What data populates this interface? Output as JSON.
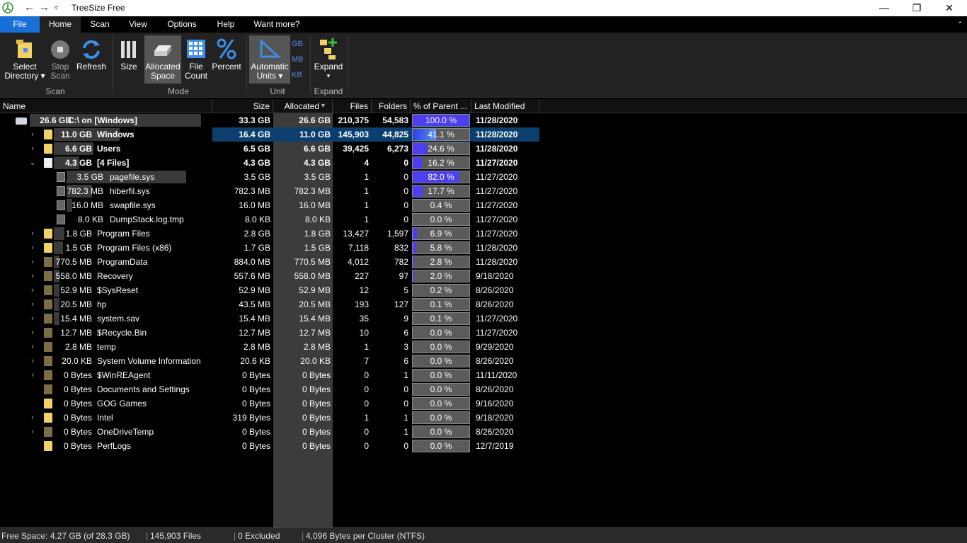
{
  "window": {
    "title": "TreeSize Free",
    "controls": [
      "—",
      "❐",
      "✕"
    ]
  },
  "menu": {
    "items": [
      "File",
      "Home",
      "Scan",
      "View",
      "Options",
      "Help",
      "Want more?"
    ]
  },
  "ribbon": {
    "select_directory": [
      "Select",
      "Directory ▾"
    ],
    "stop_scan": [
      "Stop",
      "Scan"
    ],
    "refresh": [
      "Refresh"
    ],
    "size": [
      "Size"
    ],
    "allocated_space": [
      "Allocated",
      "Space"
    ],
    "file_count": [
      "File",
      "Count"
    ],
    "percent": [
      "Percent"
    ],
    "automatic_units": [
      "Automatic",
      "Units ▾"
    ],
    "unit_gb": "GB",
    "unit_mb": "MB",
    "unit_kb": "KB",
    "expand": [
      "Expand",
      "▾"
    ],
    "groups": {
      "scan": "Scan",
      "mode": "Mode",
      "unit": "Unit",
      "expand": "Expand"
    }
  },
  "columns": {
    "name": "Name",
    "size": "Size",
    "allocated": "Allocated",
    "files": "Files",
    "folders": "Folders",
    "percent": "% of Parent ...",
    "modified": "Last Modified"
  },
  "rows": [
    {
      "expander": "⌄",
      "icon": "drive",
      "bar": 1.0,
      "alloc": "26.6 GB",
      "name": "C:\\  on  [Windows]",
      "size": "33.3 GB",
      "allocated": "26.6 GB",
      "files": "210,375",
      "folders": "54,583",
      "pct": 100.0,
      "pct_text": "100.0 %",
      "modified": "11/28/2020",
      "bold": true,
      "level": 0
    },
    {
      "expander": "›",
      "icon": "folder",
      "bar": 0.413,
      "alloc": "11.0 GB",
      "name": "Windows",
      "size": "16.4 GB",
      "allocated": "11.0 GB",
      "files": "145,903",
      "folders": "44,825",
      "pct": 41.1,
      "pct_text": "41.1 %",
      "modified": "11/28/2020",
      "bold": true,
      "level": 1,
      "selected": true
    },
    {
      "expander": "›",
      "icon": "folder",
      "bar": 0.248,
      "alloc": "6.6 GB",
      "name": "Users",
      "size": "6.5 GB",
      "allocated": "6.6 GB",
      "files": "39,425",
      "folders": "6,273",
      "pct": 24.6,
      "pct_text": "24.6 %",
      "modified": "11/28/2020",
      "bold": true,
      "level": 1
    },
    {
      "expander": "⌄",
      "icon": "file",
      "bar": 0.162,
      "alloc": "4.3 GB",
      "name": "[4 Files]",
      "size": "4.3 GB",
      "allocated": "4.3 GB",
      "files": "4",
      "folders": "0",
      "pct": 16.2,
      "pct_text": "16.2 %",
      "modified": "11/27/2020",
      "bold": true,
      "level": 1
    },
    {
      "expander": "",
      "icon": "sysfile",
      "bar": 0.82,
      "alloc": "3.5 GB",
      "name": "pagefile.sys",
      "size": "3.5 GB",
      "allocated": "3.5 GB",
      "files": "1",
      "folders": "0",
      "pct": 82.0,
      "pct_text": "82.0 %",
      "modified": "11/27/2020",
      "bold": false,
      "level": 2
    },
    {
      "expander": "",
      "icon": "sysfile",
      "bar": 0.177,
      "alloc": "782.3 MB",
      "name": "hiberfil.sys",
      "size": "782.3 MB",
      "allocated": "782.3 MB",
      "files": "1",
      "folders": "0",
      "pct": 17.7,
      "pct_text": "17.7 %",
      "modified": "11/27/2020",
      "bold": false,
      "level": 2
    },
    {
      "expander": "",
      "icon": "sysfile",
      "bar": 0.004,
      "alloc": "16.0 MB",
      "name": "swapfile.sys",
      "size": "16.0 MB",
      "allocated": "16.0 MB",
      "files": "1",
      "folders": "0",
      "pct": 0.4,
      "pct_text": "0.4 %",
      "modified": "11/27/2020",
      "bold": false,
      "level": 2
    },
    {
      "expander": "",
      "icon": "sysfile",
      "bar": 0.0,
      "alloc": "8.0 KB",
      "name": "DumpStack.log.tmp",
      "size": "8.0 KB",
      "allocated": "8.0 KB",
      "files": "1",
      "folders": "0",
      "pct": 0.0,
      "pct_text": "0.0 %",
      "modified": "11/27/2020",
      "bold": false,
      "level": 2
    },
    {
      "expander": "›",
      "icon": "folder",
      "bar": 0.069,
      "alloc": "1.8 GB",
      "name": "Program Files",
      "size": "2.8 GB",
      "allocated": "1.8 GB",
      "files": "13,427",
      "folders": "1,597",
      "pct": 6.9,
      "pct_text": "6.9 %",
      "modified": "11/27/2020",
      "bold": false,
      "level": 1
    },
    {
      "expander": "›",
      "icon": "folder",
      "bar": 0.058,
      "alloc": "1.5 GB",
      "name": "Program Files (x86)",
      "size": "1.7 GB",
      "allocated": "1.5 GB",
      "files": "7,118",
      "folders": "832",
      "pct": 5.8,
      "pct_text": "5.8 %",
      "modified": "11/28/2020",
      "bold": false,
      "level": 1
    },
    {
      "expander": "›",
      "icon": "folderdim",
      "bar": 0.028,
      "alloc": "770.5 MB",
      "name": "ProgramData",
      "size": "884.0 MB",
      "allocated": "770.5 MB",
      "files": "4,012",
      "folders": "782",
      "pct": 2.8,
      "pct_text": "2.8 %",
      "modified": "11/28/2020",
      "bold": false,
      "level": 1
    },
    {
      "expander": "›",
      "icon": "folderdim",
      "bar": 0.02,
      "alloc": "558.0 MB",
      "name": "Recovery",
      "size": "557.6 MB",
      "allocated": "558.0 MB",
      "files": "227",
      "folders": "97",
      "pct": 2.0,
      "pct_text": "2.0 %",
      "modified": "9/18/2020",
      "bold": false,
      "level": 1
    },
    {
      "expander": "›",
      "icon": "folderdim",
      "bar": 0.002,
      "alloc": "52.9 MB",
      "name": "$SysReset",
      "size": "52.9 MB",
      "allocated": "52.9 MB",
      "files": "12",
      "folders": "5",
      "pct": 0.2,
      "pct_text": "0.2 %",
      "modified": "8/26/2020",
      "bold": false,
      "level": 1
    },
    {
      "expander": "›",
      "icon": "folderdim",
      "bar": 0.001,
      "alloc": "20.5 MB",
      "name": "hp",
      "size": "43.5 MB",
      "allocated": "20.5 MB",
      "files": "193",
      "folders": "127",
      "pct": 0.1,
      "pct_text": "0.1 %",
      "modified": "8/26/2020",
      "bold": false,
      "level": 1
    },
    {
      "expander": "›",
      "icon": "folderdim",
      "bar": 0.001,
      "alloc": "15.4 MB",
      "name": "system.sav",
      "size": "15.4 MB",
      "allocated": "15.4 MB",
      "files": "35",
      "folders": "9",
      "pct": 0.1,
      "pct_text": "0.1 %",
      "modified": "11/27/2020",
      "bold": false,
      "level": 1
    },
    {
      "expander": "›",
      "icon": "folderdim",
      "bar": 0.0,
      "alloc": "12.7 MB",
      "name": "$Recycle.Bin",
      "size": "12.7 MB",
      "allocated": "12.7 MB",
      "files": "10",
      "folders": "6",
      "pct": 0.0,
      "pct_text": "0.0 %",
      "modified": "11/27/2020",
      "bold": false,
      "level": 1
    },
    {
      "expander": "›",
      "icon": "folderdim",
      "bar": 0.0,
      "alloc": "2.8 MB",
      "name": "temp",
      "size": "2.8 MB",
      "allocated": "2.8 MB",
      "files": "1",
      "folders": "3",
      "pct": 0.0,
      "pct_text": "0.0 %",
      "modified": "9/29/2020",
      "bold": false,
      "level": 1
    },
    {
      "expander": "›",
      "icon": "folderdim",
      "bar": 0.0,
      "alloc": "20.0 KB",
      "name": "System Volume Information",
      "size": "20.6 KB",
      "allocated": "20.0 KB",
      "files": "7",
      "folders": "6",
      "pct": 0.0,
      "pct_text": "0.0 %",
      "modified": "8/26/2020",
      "bold": false,
      "level": 1
    },
    {
      "expander": "›",
      "icon": "folderdim",
      "bar": 0.0,
      "alloc": "0 Bytes",
      "name": "$WinREAgent",
      "size": "0 Bytes",
      "allocated": "0 Bytes",
      "files": "0",
      "folders": "1",
      "pct": 0.0,
      "pct_text": "0.0 %",
      "modified": "11/11/2020",
      "bold": false,
      "level": 1
    },
    {
      "expander": "",
      "icon": "folderdim",
      "bar": 0.0,
      "alloc": "0 Bytes",
      "name": "Documents and Settings",
      "size": "0 Bytes",
      "allocated": "0 Bytes",
      "files": "0",
      "folders": "0",
      "pct": 0.0,
      "pct_text": "0.0 %",
      "modified": "8/26/2020",
      "bold": false,
      "level": 1
    },
    {
      "expander": "",
      "icon": "folder",
      "bar": 0.0,
      "alloc": "0 Bytes",
      "name": "GOG Games",
      "size": "0 Bytes",
      "allocated": "0 Bytes",
      "files": "0",
      "folders": "0",
      "pct": 0.0,
      "pct_text": "0.0 %",
      "modified": "9/16/2020",
      "bold": false,
      "level": 1
    },
    {
      "expander": "›",
      "icon": "folder",
      "bar": 0.0,
      "alloc": "0 Bytes",
      "name": "Intel",
      "size": "319 Bytes",
      "allocated": "0 Bytes",
      "files": "1",
      "folders": "1",
      "pct": 0.0,
      "pct_text": "0.0 %",
      "modified": "9/18/2020",
      "bold": false,
      "level": 1
    },
    {
      "expander": "›",
      "icon": "folderdim",
      "bar": 0.0,
      "alloc": "0 Bytes",
      "name": "OneDriveTemp",
      "size": "0 Bytes",
      "allocated": "0 Bytes",
      "files": "0",
      "folders": "1",
      "pct": 0.0,
      "pct_text": "0.0 %",
      "modified": "8/26/2020",
      "bold": false,
      "level": 1
    },
    {
      "expander": "",
      "icon": "folder",
      "bar": 0.0,
      "alloc": "0 Bytes",
      "name": "PerfLogs",
      "size": "0 Bytes",
      "allocated": "0 Bytes",
      "files": "0",
      "folders": "0",
      "pct": 0.0,
      "pct_text": "0.0 %",
      "modified": "12/7/2019",
      "bold": false,
      "level": 1
    }
  ],
  "status": {
    "free_space": "Free Space: 4.27 GB  (of 28.3 GB)",
    "files": "145,903 Files",
    "excluded": "0 Excluded",
    "cluster": "4,096 Bytes per Cluster (NTFS)"
  },
  "colors": {
    "accent": "#1a6ed8",
    "selection": "#0c3f6e",
    "percent_fill": "#4b3ff0",
    "folder": "#f2d166"
  }
}
